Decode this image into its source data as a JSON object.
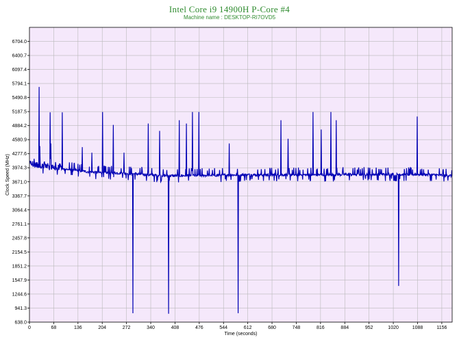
{
  "header": {
    "title": "Intel Core i9 14900H P-Core #4",
    "subtitle": "Machine name : DESKTOP-RI7OVD5"
  },
  "colors": {
    "plot_background": "#f5e8fb",
    "line": "#0000b4",
    "grid": "#b9b9b9",
    "title": "#2e8b2e"
  },
  "chart_data": {
    "type": "line",
    "title": "Intel Core i9 14900H P-Core #4",
    "subtitle": "Machine name : DESKTOP-RI7OVD5",
    "xlabel": "Time (seconds)",
    "ylabel": "Clock Speed (MHz)",
    "xlim": [
      0,
      1185
    ],
    "ylim": [
      638.0,
      7007.3
    ],
    "grid": true,
    "x_ticks": [
      0,
      68,
      136,
      204,
      272,
      340,
      408,
      476,
      544,
      612,
      680,
      748,
      816,
      884,
      952,
      1020,
      1088,
      1156
    ],
    "x_tick_labels": [
      "0",
      "68",
      "136",
      "204",
      "272",
      "340",
      "408",
      "476",
      "544",
      "612",
      "680",
      "748",
      "816",
      "884",
      "952",
      "1020",
      "1088",
      "1156"
    ],
    "y_ticks": [
      638.0,
      941.3,
      1244.6,
      1547.9,
      1851.2,
      2154.5,
      2457.8,
      2761.1,
      3064.4,
      3367.7,
      3671.0,
      3974.3,
      4277.6,
      4580.9,
      4884.2,
      5187.5,
      5490.8,
      5794.1,
      6097.4,
      6400.7,
      6704.0
    ],
    "y_tick_labels": [
      "638.0",
      "941.3",
      "1244.6",
      "1547.9",
      "1851.2",
      "2154.5",
      "2457.8",
      "2761.1",
      "3064.4",
      "3367.7",
      "3671.0",
      "3974.3",
      "4277.6",
      "4580.9",
      "4884.2",
      "5187.5",
      "5490.8",
      "5794.1",
      "6097.4",
      "6400.7",
      "6704.0"
    ],
    "series": [
      {
        "baseline": [
          [
            0,
            4040
          ],
          [
            30,
            3980
          ],
          [
            60,
            3960
          ],
          [
            120,
            3930
          ],
          [
            160,
            3890
          ],
          [
            200,
            3870
          ],
          [
            250,
            3860
          ],
          [
            300,
            3840
          ],
          [
            360,
            3810
          ],
          [
            400,
            3800
          ],
          [
            500,
            3810
          ],
          [
            600,
            3820
          ],
          [
            700,
            3820
          ],
          [
            800,
            3820
          ],
          [
            900,
            3830
          ],
          [
            1000,
            3830
          ],
          [
            1100,
            3830
          ],
          [
            1185,
            3800
          ]
        ],
        "spikes": [
          {
            "x": 27,
            "y": 5720
          },
          {
            "x": 29,
            "y": 4440
          },
          {
            "x": 58,
            "y": 5170
          },
          {
            "x": 60,
            "y": 4500
          },
          {
            "x": 92,
            "y": 5170
          },
          {
            "x": 148,
            "y": 4420
          },
          {
            "x": 175,
            "y": 4300
          },
          {
            "x": 205,
            "y": 5180
          },
          {
            "x": 235,
            "y": 4900
          },
          {
            "x": 265,
            "y": 4300
          },
          {
            "x": 333,
            "y": 4930
          },
          {
            "x": 365,
            "y": 4770
          },
          {
            "x": 420,
            "y": 5000
          },
          {
            "x": 440,
            "y": 4930
          },
          {
            "x": 457,
            "y": 5180
          },
          {
            "x": 475,
            "y": 5180
          },
          {
            "x": 560,
            "y": 4500
          },
          {
            "x": 705,
            "y": 5000
          },
          {
            "x": 725,
            "y": 4600
          },
          {
            "x": 795,
            "y": 5180
          },
          {
            "x": 818,
            "y": 4800
          },
          {
            "x": 845,
            "y": 5180
          },
          {
            "x": 860,
            "y": 5000
          },
          {
            "x": 1087,
            "y": 5080
          }
        ],
        "dips": [
          {
            "x": 290,
            "y": 830
          },
          {
            "x": 390,
            "y": 820
          },
          {
            "x": 585,
            "y": 830
          },
          {
            "x": 1035,
            "y": 1420
          }
        ]
      }
    ]
  }
}
